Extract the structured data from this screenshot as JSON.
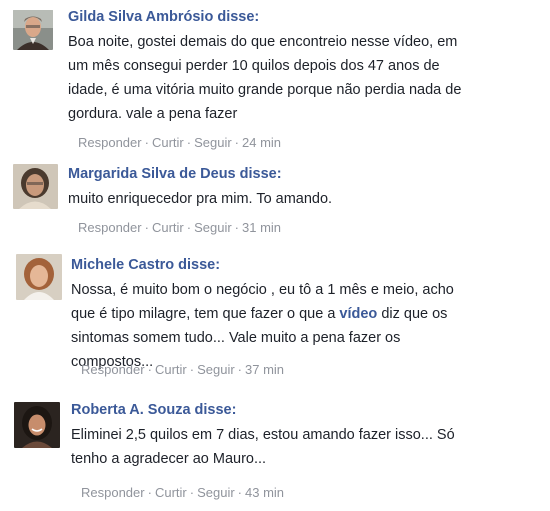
{
  "comments": [
    {
      "author": "Gilda Silva Ambrósio disse:",
      "text_parts": [
        "Boa noite, gostei demais do que encontreio nesse vídeo, em um mês consegui perder 10 quilos depois dos 47 anos de idade, é uma vitória muito grande porque não perdia nada de gordura. vale a pena fazer"
      ],
      "actions": {
        "reply": "Responder",
        "like": "Curtir",
        "follow": "Seguir",
        "time": "24 min"
      },
      "avatar_icon": "man-portrait-avatar"
    },
    {
      "author": "Margarida Silva de Deus disse:",
      "text_parts": [
        "muito enriquecedor pra mim. To amando."
      ],
      "actions": {
        "reply": "Responder",
        "like": "Curtir",
        "follow": "Seguir",
        "time": "31 min"
      },
      "avatar_icon": "woman-portrait-avatar"
    },
    {
      "author": "Michele Castro disse:",
      "text_before": "Nossa, é muito bom o negócio , eu tô a 1 mês e meio, acho que é tipo milagre, tem que fazer o que a ",
      "text_link": "vídeo",
      "text_after": " diz que os sintomas somem tudo... Vale muito a pena fazer os compostos...",
      "actions": {
        "reply": "Responder",
        "like": "Curtir",
        "follow": "Seguir",
        "time": "37 min"
      },
      "avatar_icon": "woman-portrait-avatar"
    },
    {
      "author": "Roberta A. Souza disse:",
      "text_parts": [
        "Eliminei 2,5 quilos em 7 dias, estou amando fazer isso... Só tenho a agradecer ao Mauro..."
      ],
      "actions": {
        "reply": "Responder",
        "like": "Curtir",
        "follow": "Seguir",
        "time": "43 min"
      },
      "avatar_icon": "woman-portrait-avatar"
    }
  ],
  "colors": {
    "author": "#3b5998",
    "text": "#1d2129",
    "meta": "#90949c"
  }
}
